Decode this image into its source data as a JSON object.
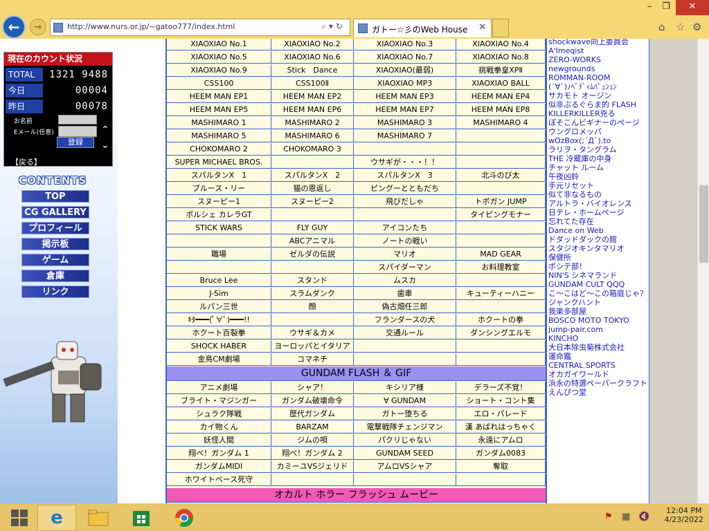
{
  "browser": {
    "url": "http://www.nurs.or.jp/~gatoo777/index.html",
    "tab_title": "ガトー☆彡のWeb House",
    "window_controls": [
      "–",
      "❐",
      "✕"
    ]
  },
  "counter": {
    "header": "現在のカウント状況",
    "rows": [
      {
        "label": "TOTAL",
        "value": "1321 9488"
      },
      {
        "label": "今日",
        "value": "00004"
      },
      {
        "label": "昨日",
        "value": "00078"
      }
    ],
    "name_label": "お名前",
    "email_label": "Eメール(任意)",
    "register_label": "登録",
    "back_label": "【戻る】"
  },
  "nav": {
    "contents_label": "CONTENTS",
    "items": [
      "TOP",
      "CG GALLERY",
      "プロフィール",
      "掲示板",
      "ゲーム",
      "倉庫",
      "リンク"
    ]
  },
  "table_rows": [
    [
      "XIAOXIAO No.1",
      "XIAOXIAO No.2",
      "XIAOXIAO No.3",
      "XIAOXIAO No.4"
    ],
    [
      "XIAOXIAO No.5",
      "XIAOXIAO No.6",
      "XIAOXIAO No.7",
      "XIAOXIAO No.8"
    ],
    [
      "XIAOXIAO No.9",
      "Stick　Dance",
      "XIAOXIAO(最弱)",
      "挑戦拳皇XPⅡ"
    ],
    [
      "CSS100",
      "CSS100Ⅱ",
      "XIAOXIAO MP3",
      "XIAOXIAO BALL"
    ],
    [
      "HEEM MAN EP1",
      "HEEM MAN EP2",
      "HEEM MAN EP3",
      "HEEM MAN EP4"
    ],
    [
      "HEEM MAN EP5",
      "HEEM MAN EP6",
      "HEEM MAN EP7",
      "HEEM MAN EP8"
    ],
    [
      "MASHIMARO 1",
      "MASHIMARO 2",
      "MASHIMARO 3",
      "MASHIMARO 4"
    ],
    [
      "MASHIMARO 5",
      "MASHIMARO 6",
      "MASHIMARO 7",
      ""
    ],
    [
      "CHOKOMARO 2",
      "CHOKOMARO 3",
      "",
      ""
    ],
    [
      "SUPER MICHAEL BROS.",
      "",
      "ウサギが・・・！！",
      ""
    ],
    [
      "スパルタンX　1",
      "スパルタンX　2",
      "スパルタンX　3",
      "北斗のび太"
    ],
    [
      "ブルース・リー",
      "猫の恩返し",
      "ピングーとともだち",
      ""
    ],
    [
      "スヌーピー1",
      "スヌーピー2",
      "飛びだしゃ",
      "トボガン JUMP"
    ],
    [
      "ポルシェ カレラGT",
      "",
      "",
      "タイピングモナー"
    ],
    [
      "STICK WARS",
      "FLY GUY",
      "アイコンたち",
      ""
    ],
    [
      "",
      "ABCアニマル",
      "ノートの戦い",
      ""
    ],
    [
      "職場",
      "ゼルダの伝説",
      "マリオ",
      "MAD GEAR"
    ],
    [
      "",
      "",
      "スパイダーマン",
      "お料理教室"
    ],
    [
      "Bruce Lee",
      "スタンド",
      "ムスカ",
      ""
    ],
    [
      "J-Sim",
      "スラムダンク",
      "歯車",
      "キューティーハニー"
    ],
    [
      "ルパン三世",
      "顔",
      "偽古畑任三郎",
      ""
    ],
    [
      "ｷﾀ━━━(ﾟ∀ﾟ)━━━!!",
      "",
      "フランダースの犬",
      "ホクートの拳"
    ],
    [
      "ホクート百裂拳",
      "ウサギ＆カメ",
      "交通ルール",
      "ダンシングエルモ"
    ],
    [
      "SHOCK HABER",
      "ヨーロッパとイタリア",
      "",
      ""
    ],
    [
      "金鳥CM劇場",
      "コマネチ",
      "",
      ""
    ]
  ],
  "section1": "GUNDAM FLASH ＆ GIF",
  "gundam_rows": [
    [
      "アニメ劇場",
      "シャア！",
      "キシリア様",
      "デラーズ不覚！"
    ],
    [
      "ブライト・マジンガー",
      "ガンダム破壊命令",
      "∀ GUNDAM",
      "ショート・コント集"
    ],
    [
      "シュラク隊戦",
      "歴代ガンダム",
      "ガトー堕ちる",
      "エロ・パレード"
    ],
    [
      "カイ物くん",
      "BARZAM",
      "電撃戦隊チェンジマン",
      "漢 あばれはっちゃく"
    ],
    [
      "妖怪人間",
      "ジムの唄",
      "パクリじゃない",
      "永遠にアムロ"
    ],
    [
      "翔べ！ガンダム 1",
      "翔べ！ガンダム 2",
      "GUNDAM SEED",
      "ガンダム0083"
    ],
    [
      "ガンダムMIDI",
      "カミーユVSジェリド",
      "アムロVSシャア",
      "奪取"
    ],
    [
      "ホワイトベース死守",
      "",
      "",
      ""
    ]
  ],
  "section2": "オカルト ホラー フラッシュ ムービー",
  "links": [
    "shockwave向上委員会",
    "A'Imeqist",
    "ZERO-WORKS",
    "newgrounds",
    "ROMMAN-ROOM",
    "(´∀`)ﾉﾍﾞﾃﾞｨﾑﾊﾟｭﾝｭﾝ",
    "サカモト オージン",
    "似非ぷるぐらま的 FLASH",
    "KILLERKILLER兇る",
    "ぽそこんビギナーのページ",
    "ウングロメッパ",
    "wOzBox(;´Д`).to",
    "ラリヲ・タングラム",
    "THE 冷蔵庫の中身",
    "チャット ルーム",
    "午夜凶鈴",
    "手元リセット",
    "似て非なるもの",
    "アルトラ・バイオレンス",
    "日テレ・ホームページ",
    "忘れてた存在",
    "Dance on Web",
    "ドダッドダックの館",
    "スタジオキンタマリオ",
    "保健所",
    "ポシテ部！",
    "NIN'S シネマランド",
    "GUNDAM CULT QQQ",
    "こ～こはど～この箱庭じゃ？",
    "ジャンクハント",
    "我楽多部屋",
    "BOSCO MOTO TOKYO",
    "jump-pair.com",
    "KINCHO",
    "大日本除虫菊株式会社",
    "運命鑑",
    "CENTRAL SPORTS",
    "オカガイワールド",
    "浜永の特選ペーパークラフト",
    "えんぴつ堂"
  ],
  "clock": {
    "time": "12:04 PM",
    "date": "4/23/2022"
  },
  "colors": {
    "border": "#3c63d4",
    "section_purple": "#9b8ff2",
    "section_pink": "#f05ab4",
    "link": "#1a15c6"
  }
}
